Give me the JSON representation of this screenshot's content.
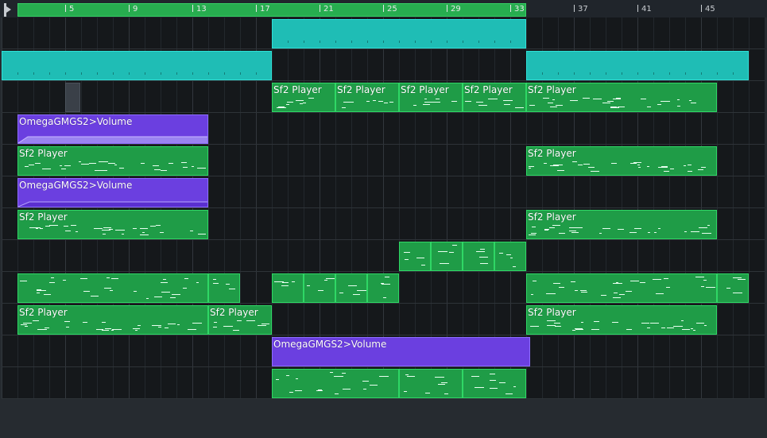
{
  "timeline": {
    "bar_labels": [
      {
        "text": "5"
      },
      {
        "text": "9"
      },
      {
        "text": "13"
      },
      {
        "text": "17"
      },
      {
        "text": "21"
      },
      {
        "text": "25"
      },
      {
        "text": "29"
      },
      {
        "text": "33"
      },
      {
        "text": "37"
      },
      {
        "text": "41"
      },
      {
        "text": "45"
      }
    ]
  },
  "clip_names": {
    "sf2": "Sf2 Player",
    "volume": "OmegaGMGS2>Volume"
  },
  "colors": {
    "pattern": "#1f9c47",
    "audio": "#1fbdb5",
    "automation": "#6b3fe0"
  }
}
